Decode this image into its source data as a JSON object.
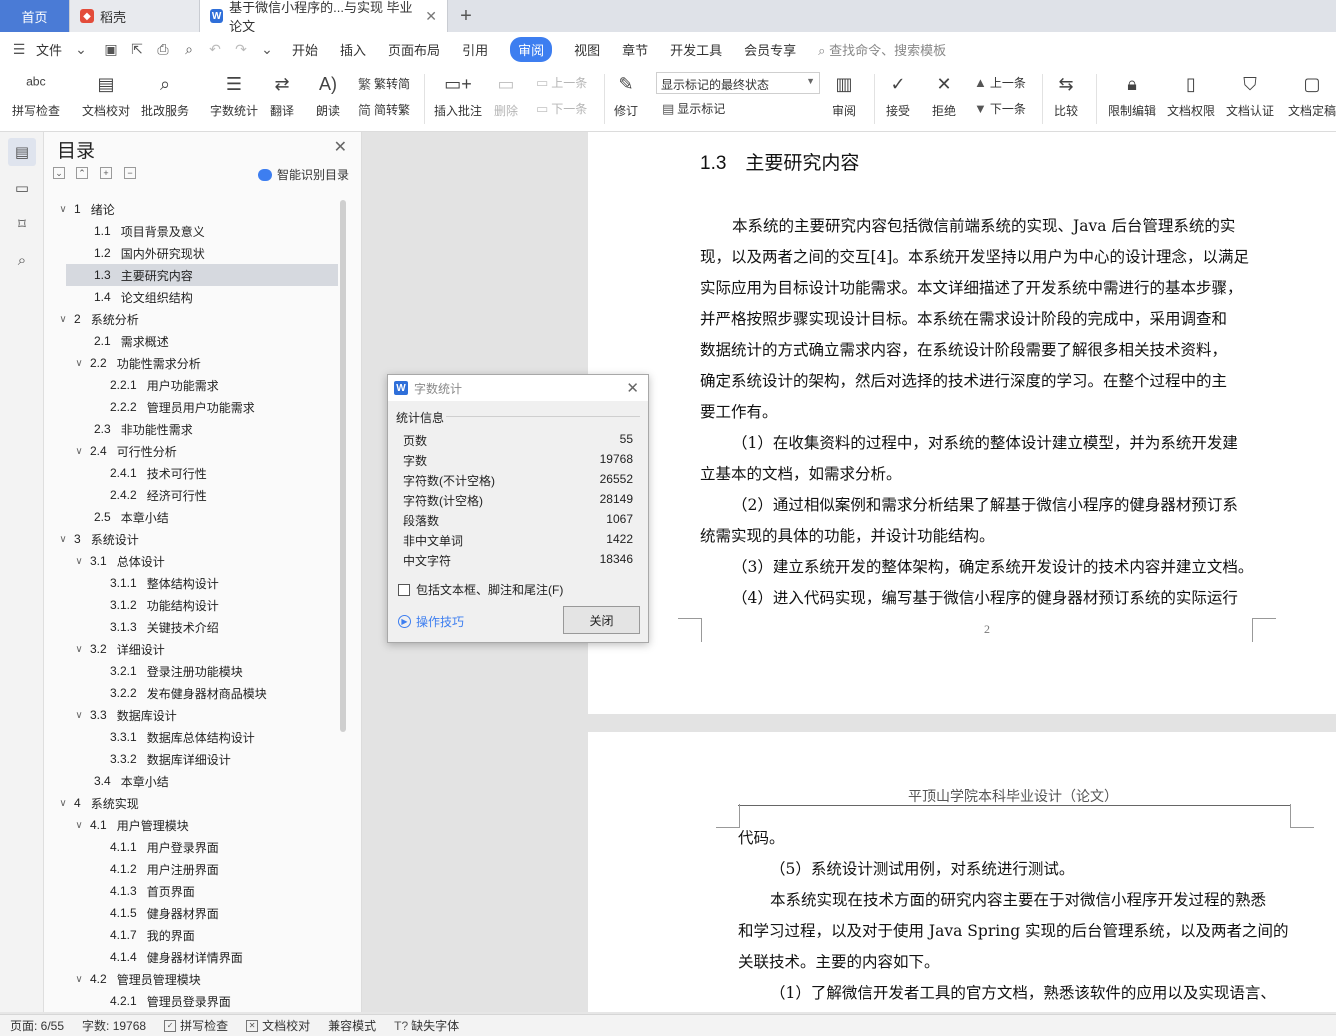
{
  "tabs": {
    "home": "首页",
    "daoke": "稻壳",
    "active_doc": "基于微信小程序的...与实现 毕业论文",
    "new_tab": "+"
  },
  "menu": {
    "file": "文件",
    "items": [
      "开始",
      "插入",
      "页面布局",
      "引用",
      "审阅",
      "视图",
      "章节",
      "开发工具",
      "会员专享"
    ],
    "active": "审阅",
    "search": "查找命令、搜索模板"
  },
  "ribbon": {
    "spell_check": "拼写检查",
    "doc_proof": "文档校对",
    "batch_service": "批改服务",
    "word_count": "字数统计",
    "translate": "翻译",
    "read_aloud": "朗读",
    "trad_to_simp": "繁转简",
    "simp_to_trad": "简转繁",
    "insert_comment": "插入批注",
    "delete": "删除",
    "prev": "上一条",
    "next": "下一条",
    "track_changes": "修订",
    "markup_mode": "显示标记的最终状态",
    "show_markup": "显示标记",
    "review": "审阅",
    "accept": "接受",
    "reject": "拒绝",
    "prev2": "上一条",
    "next2": "下一条",
    "compare": "比较",
    "restrict_edit": "限制编辑",
    "doc_rights": "文档权限",
    "doc_cert": "文档认证",
    "doc_final": "文档定稿"
  },
  "nav": {
    "title": "目录",
    "smart_toc": "智能识别目录",
    "items": [
      {
        "level": 1,
        "arrow": "∨",
        "num": "1",
        "text": "绪论"
      },
      {
        "level": 2,
        "arrow": "",
        "num": "1.1",
        "text": "项目背景及意义"
      },
      {
        "level": 2,
        "arrow": "",
        "num": "1.2",
        "text": "国内外研究现状"
      },
      {
        "level": 2,
        "arrow": "",
        "num": "1.3",
        "text": "主要研究内容",
        "selected": true
      },
      {
        "level": 2,
        "arrow": "",
        "num": "1.4",
        "text": "论文组织结构"
      },
      {
        "level": 1,
        "arrow": "∨",
        "num": "2",
        "text": "系统分析"
      },
      {
        "level": 2,
        "arrow": "",
        "num": "2.1",
        "text": "需求概述"
      },
      {
        "level": 2,
        "arrow": "∨",
        "num": "2.2",
        "text": "功能性需求分析"
      },
      {
        "level": 3,
        "arrow": "",
        "num": "2.2.1",
        "text": "用户功能需求"
      },
      {
        "level": 3,
        "arrow": "",
        "num": "2.2.2",
        "text": "管理员用户功能需求"
      },
      {
        "level": 2,
        "arrow": "",
        "num": "2.3",
        "text": "非功能性需求"
      },
      {
        "level": 2,
        "arrow": "∨",
        "num": "2.4",
        "text": "可行性分析"
      },
      {
        "level": 3,
        "arrow": "",
        "num": "2.4.1",
        "text": "技术可行性"
      },
      {
        "level": 3,
        "arrow": "",
        "num": "2.4.2",
        "text": "经济可行性"
      },
      {
        "level": 2,
        "arrow": "",
        "num": "2.5",
        "text": "本章小结"
      },
      {
        "level": 1,
        "arrow": "∨",
        "num": "3",
        "text": "系统设计"
      },
      {
        "level": 2,
        "arrow": "∨",
        "num": "3.1",
        "text": "总体设计"
      },
      {
        "level": 3,
        "arrow": "",
        "num": "3.1.1",
        "text": "整体结构设计"
      },
      {
        "level": 3,
        "arrow": "",
        "num": "3.1.2",
        "text": "功能结构设计"
      },
      {
        "level": 3,
        "arrow": "",
        "num": "3.1.3",
        "text": "关键技术介绍"
      },
      {
        "level": 2,
        "arrow": "∨",
        "num": "3.2",
        "text": "详细设计"
      },
      {
        "level": 3,
        "arrow": "",
        "num": "3.2.1",
        "text": "登录注册功能模块"
      },
      {
        "level": 3,
        "arrow": "",
        "num": "3.2.2",
        "text": "发布健身器材商品模块"
      },
      {
        "level": 2,
        "arrow": "∨",
        "num": "3.3",
        "text": "数据库设计"
      },
      {
        "level": 3,
        "arrow": "",
        "num": "3.3.1",
        "text": "数据库总体结构设计"
      },
      {
        "level": 3,
        "arrow": "",
        "num": "3.3.2",
        "text": "数据库详细设计"
      },
      {
        "level": 2,
        "arrow": "",
        "num": "3.4",
        "text": "本章小结"
      },
      {
        "level": 1,
        "arrow": "∨",
        "num": "4",
        "text": "系统实现"
      },
      {
        "level": 2,
        "arrow": "∨",
        "num": "4.1",
        "text": "用户管理模块"
      },
      {
        "level": 3,
        "arrow": "",
        "num": "4.1.1",
        "text": "用户登录界面"
      },
      {
        "level": 3,
        "arrow": "",
        "num": "4.1.2",
        "text": "用户注册界面"
      },
      {
        "level": 3,
        "arrow": "",
        "num": "4.1.3",
        "text": "首页界面"
      },
      {
        "level": 3,
        "arrow": "",
        "num": "4.1.5",
        "text": "健身器材界面"
      },
      {
        "level": 3,
        "arrow": "",
        "num": "4.1.7",
        "text": "我的界面"
      },
      {
        "level": 3,
        "arrow": "",
        "num": "4.1.4",
        "text": "健身器材详情界面"
      },
      {
        "level": 2,
        "arrow": "∨",
        "num": "4.2",
        "text": "管理员管理模块"
      },
      {
        "level": 3,
        "arrow": "",
        "num": "4.2.1",
        "text": "管理员登录界面"
      }
    ]
  },
  "document": {
    "heading": "1.3　主要研究内容",
    "page1_lines": [
      "本系统的主要研究内容包括微信前端系统的实现、Java 后台管理系统的实",
      "现，以及两者之间的交互[4]。本系统开发坚持以用户为中心的设计理念，以满足",
      "实际应用为目标设计功能需求。本文详细描述了开发系统中需进行的基本步骤，",
      "并严格按照步骤实现设计目标。本系统在需求设计阶段的完成中，采用调查和",
      "数据统计的方式确立需求内容，在系统设计阶段需要了解很多相关技术资料，",
      "确定系统设计的架构，然后对选择的技术进行深度的学习。在整个过程中的主",
      "要工作有。",
      "（1）在收集资料的过程中，对系统的整体设计建立模型，并为系统开发建",
      "立基本的文档，如需求分析。",
      "（2）通过相似案例和需求分析结果了解基于微信小程序的健身器材预订系",
      "统需实现的具体的功能，并设计功能结构。",
      "（3）建立系统开发的整体架构，确定系统开发设计的技术内容并建立文档。",
      "（4）进入代码实现，编写基于微信小程序的健身器材预订系统的实际运行"
    ],
    "page1_number": "2",
    "page2_header": "平顶山学院本科毕业设计（论文）",
    "page2_lines": [
      "代码。",
      "（5）系统设计测试用例，对系统进行测试。",
      "本系统实现在技术方面的研究内容主要在于对微信小程序开发过程的熟悉",
      "和学习过程，以及对于使用 Java Spring 实现的后台管理系统，以及两者之间的",
      "关联技术。主要的内容如下。",
      "（1）了解微信开发者工具的官方文档，熟悉该软件的应用以及实现语言、"
    ]
  },
  "dialog": {
    "title": "字数统计",
    "group_label": "统计信息",
    "stats": [
      {
        "label": "页数",
        "value": "55"
      },
      {
        "label": "字数",
        "value": "19768"
      },
      {
        "label": "字符数(不计空格)",
        "value": "26552"
      },
      {
        "label": "字符数(计空格)",
        "value": "28149"
      },
      {
        "label": "段落数",
        "value": "1067"
      },
      {
        "label": "非中文单词",
        "value": "1422"
      },
      {
        "label": "中文字符",
        "value": "18346"
      }
    ],
    "checkbox_label": "包括文本框、脚注和尾注(F)",
    "tips": "操作技巧",
    "close_button": "关闭"
  },
  "status": {
    "page": "页面: 6/55",
    "words": "字数: 19768",
    "spell_check": "拼写检查",
    "doc_proof": "文档校对",
    "compat": "兼容模式",
    "missing_fonts": "缺失字体"
  },
  "colors": {
    "accent": "#3d7ef0",
    "tab_home": "#4a7bd6",
    "toc_selected": "#d6d9df"
  }
}
